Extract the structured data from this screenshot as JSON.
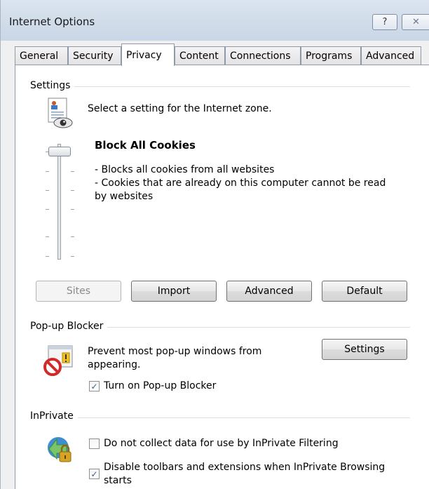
{
  "window": {
    "title": "Internet Options",
    "help_glyph": "?",
    "close_glyph": "✕"
  },
  "tabs": [
    {
      "label": "General"
    },
    {
      "label": "Security"
    },
    {
      "label": "Privacy",
      "active": true
    },
    {
      "label": "Content"
    },
    {
      "label": "Connections"
    },
    {
      "label": "Programs"
    },
    {
      "label": "Advanced"
    }
  ],
  "settings": {
    "group_label": "Settings",
    "zone_text": "Select a setting for the Internet zone.",
    "slider_level": 1.0,
    "level_title": "Block All Cookies",
    "level_description": "- Blocks all cookies from all websites\n- Cookies that are already on this computer cannot be read\nby websites",
    "buttons": {
      "sites": "Sites",
      "import": "Import",
      "advanced": "Advanced",
      "default": "Default"
    }
  },
  "popup_blocker": {
    "group_label": "Pop-up Blocker",
    "description": "Prevent most pop-up windows from appearing.",
    "settings_button": "Settings",
    "turn_on_label": "Turn on Pop-up Blocker",
    "turn_on_checked": true
  },
  "inprivate": {
    "group_label": "InPrivate",
    "no_data_label": "Do not collect data for use by InPrivate Filtering",
    "no_data_checked": false,
    "disable_toolbars_label": "Disable toolbars and extensions when InPrivate Browsing starts",
    "disable_toolbars_checked": true
  },
  "icons": {
    "privacy": "privacy-document-eye-icon",
    "popup": "popup-blocked-icon",
    "inprivate": "inprivate-lock-icon",
    "checkmark": "✓"
  }
}
